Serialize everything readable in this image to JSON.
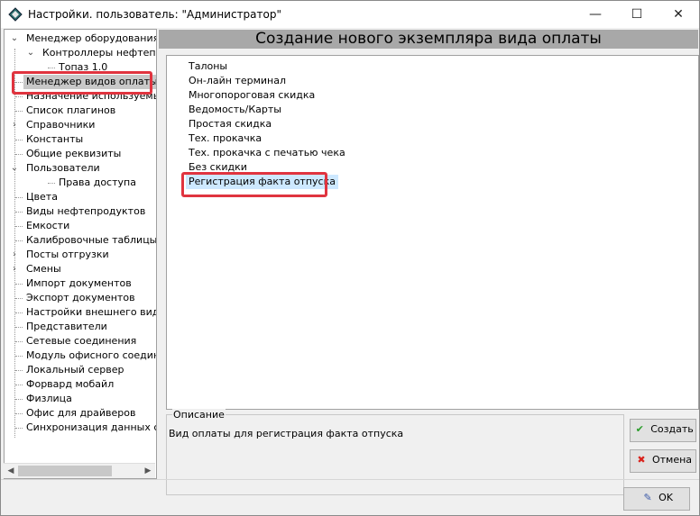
{
  "window": {
    "title": "Настройки. пользователь: \"Администратор\"",
    "controls": {
      "minimize": "—",
      "maximize": "☐",
      "close": "✕"
    }
  },
  "tree": {
    "items": [
      {
        "label": "Менеджер оборудования",
        "expander": "⌄"
      },
      {
        "label": "Контроллеры нефтепро",
        "expander": "⌄"
      },
      {
        "label": "Топаз 1.0",
        "expander": ""
      },
      {
        "label": "Менеджер видов оплаты",
        "expander": ""
      },
      {
        "label": "Назначение используемых у",
        "expander": ""
      },
      {
        "label": "Список плагинов",
        "expander": ""
      },
      {
        "label": "Справочники",
        "expander": "›"
      },
      {
        "label": "Константы",
        "expander": ""
      },
      {
        "label": "Общие реквизиты",
        "expander": ""
      },
      {
        "label": "Пользователи",
        "expander": "⌄"
      },
      {
        "label": "Права доступа",
        "expander": ""
      },
      {
        "label": "Цвета",
        "expander": ""
      },
      {
        "label": "Виды нефтепродуктов",
        "expander": ""
      },
      {
        "label": "Емкости",
        "expander": ""
      },
      {
        "label": "Калибровочные таблицы",
        "expander": ""
      },
      {
        "label": "Посты отгрузки",
        "expander": "›"
      },
      {
        "label": "Смены",
        "expander": "›"
      },
      {
        "label": "Импорт документов",
        "expander": ""
      },
      {
        "label": "Экспорт документов",
        "expander": ""
      },
      {
        "label": "Настройки внешнего вида",
        "expander": ""
      },
      {
        "label": "Представители",
        "expander": ""
      },
      {
        "label": "Сетевые соединения",
        "expander": ""
      },
      {
        "label": "Модуль офисного соединен",
        "expander": ""
      },
      {
        "label": "Локальный сервер",
        "expander": ""
      },
      {
        "label": "Форвард мобайл",
        "expander": ""
      },
      {
        "label": "Физлица",
        "expander": ""
      },
      {
        "label": "Офис для драйверов",
        "expander": ""
      },
      {
        "label": "Синхронизация данных с W",
        "expander": ""
      }
    ],
    "scroll": {
      "left": "◀",
      "right": "▶"
    }
  },
  "main": {
    "header": "Создание нового экземпляра вида оплаты",
    "payment_types": [
      "Талоны",
      "Он-лайн терминал",
      "Многопороговая скидка",
      "Ведомость/Карты",
      "Простая скидка",
      "Тех. прокачка",
      "Тех. прокачка с печатью чека",
      "Без скидки",
      "Регистрация факта отпуска"
    ],
    "description": {
      "legend": "Описание",
      "text": "Вид оплаты для регистрация факта отпуска"
    }
  },
  "buttons": {
    "create": {
      "label": "Создать",
      "icon": "✔"
    },
    "cancel": {
      "label": "Отмена",
      "icon": "✖"
    },
    "ok": {
      "label": "OK",
      "icon": "✎"
    }
  },
  "colors": {
    "highlight_box": "#e0343f",
    "header_bg": "#a8a8a8",
    "selected_item_bg": "#cde8ff",
    "tree_selected_bg": "#c8c8c8",
    "create_icon": "#2a9d2a",
    "cancel_icon": "#d9221c"
  }
}
